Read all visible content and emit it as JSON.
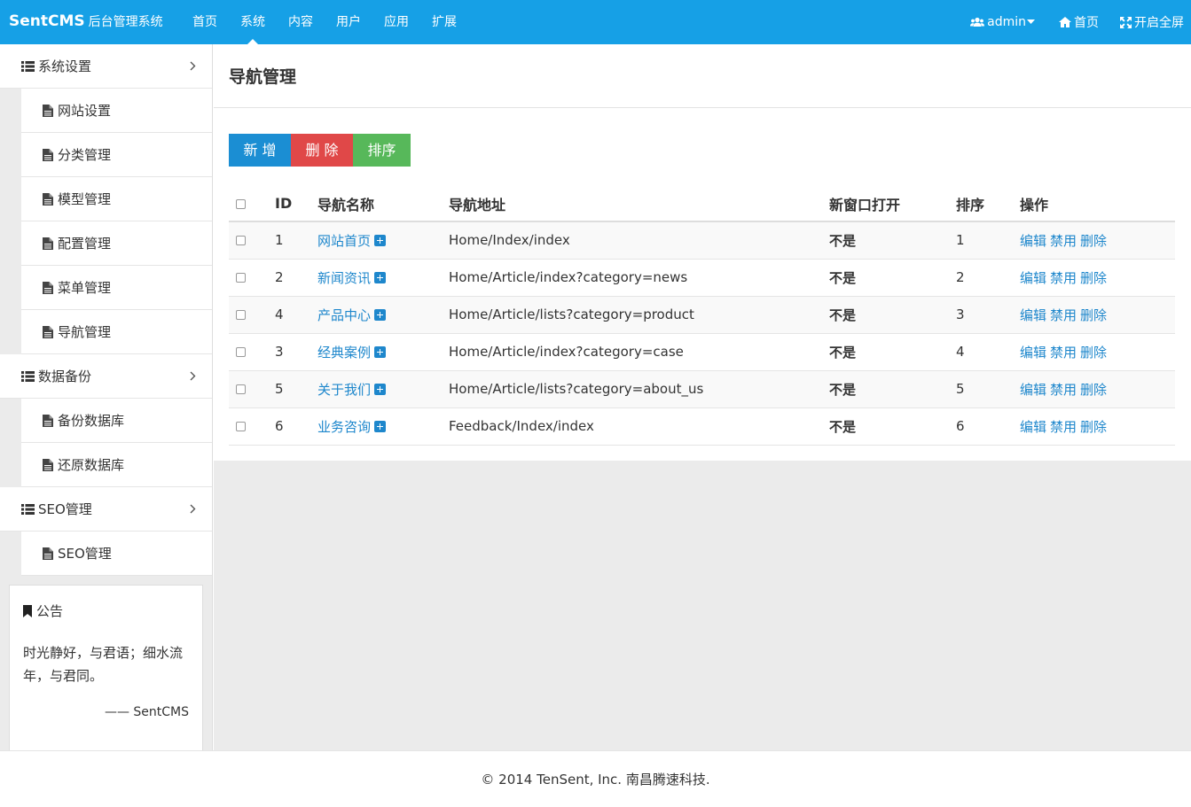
{
  "header": {
    "brand": "SentCMS",
    "brand_sub": "后台管理系统",
    "nav": [
      "首页",
      "系统",
      "内容",
      "用户",
      "应用",
      "扩展"
    ],
    "user": "admin",
    "home": "首页",
    "fullscreen": "开启全屏"
  },
  "sidebar": {
    "groups": [
      {
        "title": "系统设置",
        "items": [
          "网站设置",
          "分类管理",
          "模型管理",
          "配置管理",
          "菜单管理",
          "导航管理"
        ]
      },
      {
        "title": "数据备份",
        "items": [
          "备份数据库",
          "还原数据库"
        ]
      },
      {
        "title": "SEO管理",
        "items": [
          "SEO管理"
        ]
      }
    ],
    "notice": {
      "title": "公告",
      "text": "时光静好，与君语；细水流年，与君同。",
      "sign": "—— SentCMS"
    }
  },
  "main": {
    "title": "导航管理",
    "buttons": {
      "add": "新 增",
      "delete": "删 除",
      "sort": "排序"
    },
    "columns": [
      "ID",
      "导航名称",
      "导航地址",
      "新窗口打开",
      "排序",
      "操作"
    ],
    "rows": [
      {
        "id": "1",
        "name": "网站首页",
        "url": "Home/Index/index",
        "target": "不是",
        "sort": "1"
      },
      {
        "id": "2",
        "name": "新闻资讯",
        "url": "Home/Article/index?category=news",
        "target": "不是",
        "sort": "2"
      },
      {
        "id": "4",
        "name": "产品中心",
        "url": "Home/Article/lists?category=product",
        "target": "不是",
        "sort": "3"
      },
      {
        "id": "3",
        "name": "经典案例",
        "url": "Home/Article/index?category=case",
        "target": "不是",
        "sort": "4"
      },
      {
        "id": "5",
        "name": "关于我们",
        "url": "Home/Article/lists?category=about_us",
        "target": "不是",
        "sort": "5"
      },
      {
        "id": "6",
        "name": "业务咨询",
        "url": "Feedback/Index/index",
        "target": "不是",
        "sort": "6"
      }
    ],
    "ops": {
      "edit": "编辑",
      "disable": "禁用",
      "delete": "删除"
    }
  },
  "footer": {
    "text": "© 2014 TenSent, Inc. 南昌腾速科技."
  },
  "colors": {
    "topbar": "#16a0e6",
    "link": "#1e87cc",
    "btn_blue": "#1b8ed3",
    "btn_red": "#e04848",
    "btn_green": "#57b85a"
  }
}
